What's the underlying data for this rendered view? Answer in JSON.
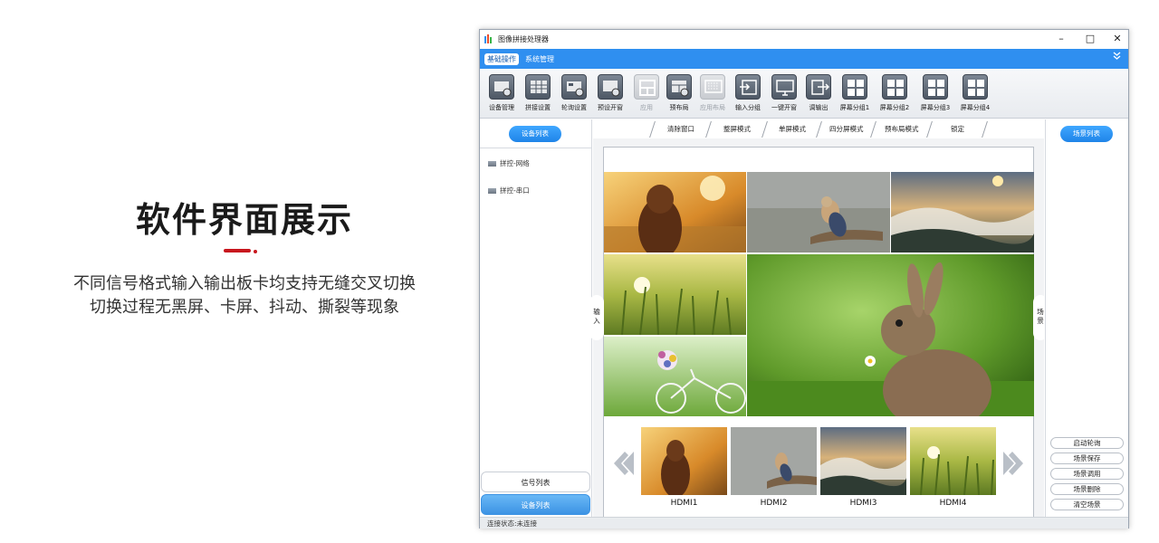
{
  "promo": {
    "title": "软件界面展示",
    "line1": "不同信号格式输入输出板卡均支持无缝交叉切换",
    "line2": "切换过程无黑屏、卡屏、抖动、撕裂等现象"
  },
  "window": {
    "title": "图像拼接处理器",
    "controls": {
      "minimize": "–",
      "maximize": "□",
      "close": "✕"
    }
  },
  "menubar": {
    "items": [
      "基础操作",
      "系统管理"
    ],
    "active_index": 0,
    "collapse_icon": "double-chevron-down-icon"
  },
  "toolbar": {
    "items": [
      {
        "label": "设备管理",
        "icon": "device-manage-icon",
        "enabled": true
      },
      {
        "label": "拼接设置",
        "icon": "splice-settings-icon",
        "enabled": true
      },
      {
        "label": "轮询设置",
        "icon": "poll-settings-icon",
        "enabled": true
      },
      {
        "label": "预设开窗",
        "icon": "preset-window-icon",
        "enabled": true
      },
      {
        "label": "应用",
        "icon": "apply-icon",
        "enabled": false
      },
      {
        "label": "预布局",
        "icon": "prelayout-icon",
        "enabled": true
      },
      {
        "label": "应用布局",
        "icon": "apply-layout-icon",
        "enabled": false
      },
      {
        "label": "输入分组",
        "icon": "input-group-icon",
        "enabled": true
      },
      {
        "label": "一键开窗",
        "icon": "one-key-window-icon",
        "enabled": true
      },
      {
        "label": "调输出",
        "icon": "output-adjust-icon",
        "enabled": true
      },
      {
        "label": "屏幕分组1",
        "icon": "screen-group-icon",
        "enabled": true
      },
      {
        "label": "屏幕分组2",
        "icon": "screen-group-icon",
        "enabled": true
      },
      {
        "label": "屏幕分组3",
        "icon": "screen-group-icon",
        "enabled": true
      },
      {
        "label": "屏幕分组4",
        "icon": "screen-group-icon",
        "enabled": true
      }
    ]
  },
  "left_panel": {
    "header": "设备列表",
    "devices": [
      "拼控-网络",
      "拼控-串口"
    ],
    "bottom_tabs": [
      "信号列表",
      "设备列表"
    ],
    "active_bottom_tab": 1
  },
  "mode_tabs": [
    "清除窗口",
    "整屏模式",
    "单屏模式",
    "四分屏模式",
    "预布局模式",
    "锁定"
  ],
  "canvas": {
    "side_input_label": "输入",
    "side_scene_label": "场景"
  },
  "thumbnails": [
    "HDMI1",
    "HDMI2",
    "HDMI3",
    "HDMI4"
  ],
  "right_panel": {
    "header": "场景列表",
    "buttons": [
      "启动轮询",
      "场景保存",
      "场景调用",
      "场景删除",
      "清空场景"
    ]
  },
  "status": {
    "text": "连接状态:未连接"
  },
  "colors": {
    "accent": "#2f8ff0",
    "promo_rule": "#c8171e"
  }
}
